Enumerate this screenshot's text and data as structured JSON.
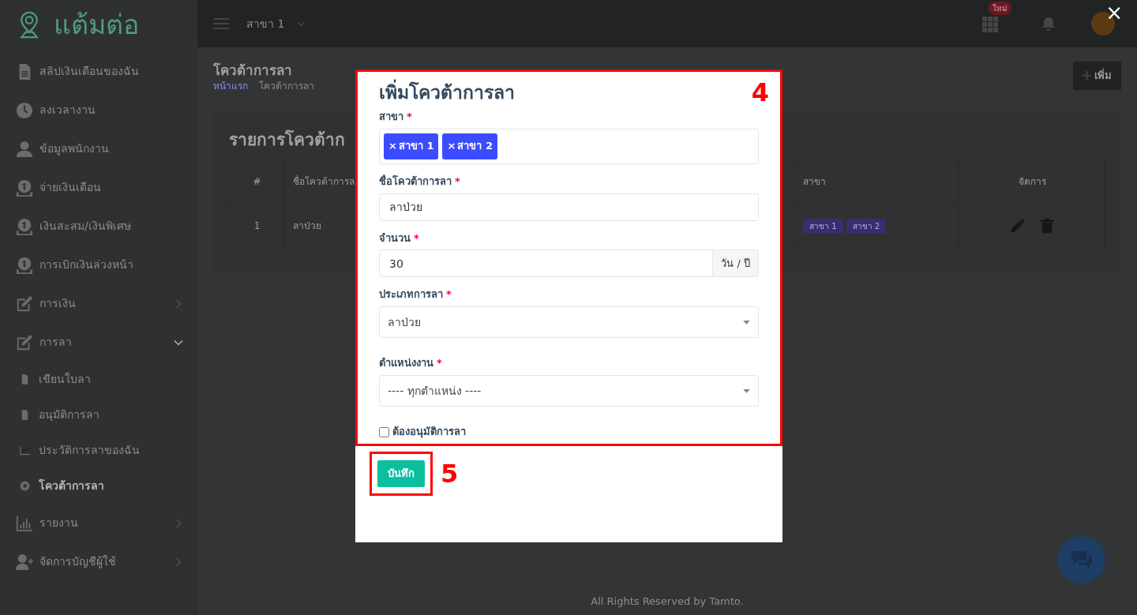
{
  "close": "×",
  "sidebar": {
    "logo": "แต้มต่อ",
    "items": [
      {
        "label": "สลิปเงินเดือนของฉัน"
      },
      {
        "label": "ลงเวลางาน"
      },
      {
        "label": "ข้อมูลพนักงาน"
      },
      {
        "label": "จ่ายเงินเดือน"
      },
      {
        "label": "เงินสะสม/เงินพิเศษ"
      },
      {
        "label": "การเบิกเงินล่วงหน้า"
      },
      {
        "label": "การเงิน",
        "expanded": false
      },
      {
        "label": "การลา",
        "expanded": true,
        "children": [
          {
            "label": "เขียนใบลา",
            "selected": false
          },
          {
            "label": "อนุมัติการลา",
            "selected": false
          },
          {
            "label": "ประวัติการลาของฉัน",
            "selected": false
          },
          {
            "label": "โควต้าการลา",
            "selected": true
          }
        ]
      },
      {
        "label": "รายงาน",
        "expanded": false
      },
      {
        "label": "จัดการบัญชีผู้ใช้",
        "expanded": false
      }
    ]
  },
  "topbar": {
    "branch": "สาขา 1",
    "apps_badge": "ใหม่"
  },
  "page": {
    "title": "โควต้าการลา",
    "breadcrumb": [
      "หน้าแรก",
      "โควต้าการลา"
    ],
    "add_button": "เพิ่ม"
  },
  "card": {
    "title": "รายการโควต้าก",
    "table": {
      "columns": [
        "#",
        "ชื่อโควต้าการล",
        "สาขา",
        "จัดการ"
      ],
      "rows": [
        {
          "cells": [
            "1",
            "ลาป่วย"
          ],
          "branches": [
            "สาขา 1",
            "สาขา 2"
          ]
        }
      ]
    }
  },
  "modal": {
    "title": "เพิ่มโควต้าการลา",
    "fields": [
      {
        "kind": "tags",
        "label": "สาขา",
        "required_mark": "*",
        "tags": [
          {
            "remove": "×",
            "label": "สาขา 1"
          },
          {
            "remove": "×",
            "label": "สาขา 2"
          }
        ]
      },
      {
        "kind": "text",
        "label": "ชื่อโควต้าการลา",
        "required_mark": "*",
        "value": "ลาป่วย"
      },
      {
        "kind": "number",
        "label": "จำนวน",
        "required_mark": "*",
        "value": "30",
        "suffix": "วัน / ปี"
      },
      {
        "kind": "select",
        "label": "ประเภทการลา",
        "required_mark": "*",
        "value": "ลาป่วย"
      },
      {
        "kind": "select",
        "label": "ตำแหน่งงาน",
        "required_mark": "*",
        "value": "---- ทุกตำแหน่ง ----"
      },
      {
        "kind": "checkbox",
        "label": "ต้องอนุมัติการลา",
        "checked": false
      }
    ],
    "save_button": "บันทึก"
  },
  "annotations": [
    {
      "label": "4"
    },
    {
      "label": "5"
    }
  ],
  "footer": "All Rights Reserved by Tamto."
}
